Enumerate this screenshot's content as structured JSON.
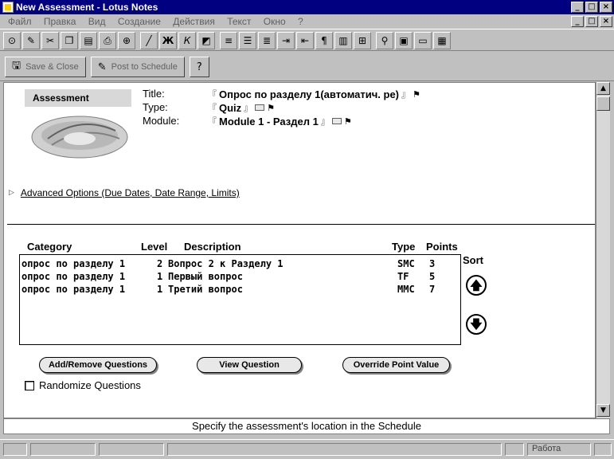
{
  "window": {
    "title": "New Assessment - Lotus Notes",
    "minimize": "_",
    "maximize": "□",
    "close": "×"
  },
  "menu": [
    "Файл",
    "Правка",
    "Вид",
    "Создание",
    "Действия",
    "Текст",
    "Окно",
    "?"
  ],
  "toolbar_icons": [
    "save-icon",
    "edit-icon",
    "cut-icon",
    "copy-icon",
    "paste-icon",
    "print-icon",
    "attach-icon",
    "pen-icon",
    "bold-icon",
    "italic-icon",
    "highlight-icon",
    "list-icon",
    "align-left-icon",
    "align-center-icon",
    "indent-icon",
    "outdent-icon",
    "paragraph-icon",
    "bullet-icon",
    "table-icon",
    "link-icon",
    "book-icon",
    "screen-icon",
    "grid-icon"
  ],
  "actions": {
    "save_close": {
      "label": "Save & Close",
      "icon": "save-close-icon"
    },
    "post_schedule": {
      "label": "Post to Schedule",
      "icon": "pencil-icon"
    },
    "help": {
      "label": "?",
      "icon": "help-icon"
    }
  },
  "form": {
    "header_label": "Assessment",
    "title_label": "Title:",
    "title_value": "Опрос по разделу 1(автоматич. ре)",
    "type_label": "Type:",
    "type_value": "Quiz",
    "module_label": "Module:",
    "module_value": "Module 1 - Раздел 1",
    "field_open": "『",
    "field_close": "』"
  },
  "advanced_options": "Advanced Options (Due Dates, Date Range, Limits)",
  "questions": {
    "headers": {
      "category": "Category",
      "level": "Level",
      "description": "Description",
      "type": "Type",
      "points": "Points"
    },
    "rows": [
      {
        "category": "опрос по разделу 1",
        "level": "2",
        "description": "Вопрос 2 к Разделу 1",
        "type": "SMC",
        "points": "3"
      },
      {
        "category": "опрос по разделу 1",
        "level": "1",
        "description": "Первый вопрос",
        "type": "TF",
        "points": "5"
      },
      {
        "category": "опрос по разделу 1",
        "level": "1",
        "description": "Третий вопрос",
        "type": "MMC",
        "points": "7"
      }
    ],
    "sort_label": "Sort",
    "sort_up": "🡅",
    "sort_down": "🡇"
  },
  "buttons": {
    "add_remove": "Add/Remove Questions",
    "view": "View Question",
    "override": "Override Point Value"
  },
  "randomize_label": "Randomize Questions",
  "randomize_checked": false,
  "hint": "Specify the assessment's location in the Schedule",
  "status": {
    "office": "Работа"
  }
}
